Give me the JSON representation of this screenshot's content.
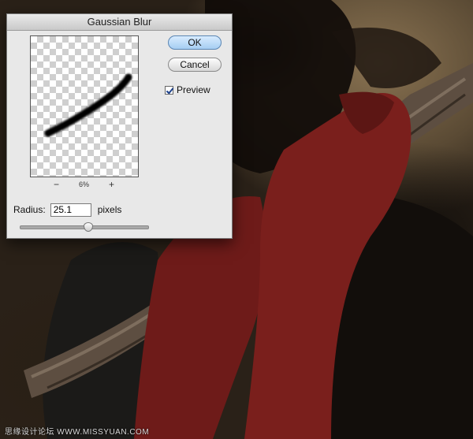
{
  "dialog": {
    "title": "Gaussian Blur",
    "ok_label": "OK",
    "cancel_label": "Cancel",
    "preview_label": "Preview",
    "preview_checked": true,
    "zoom_out": "−",
    "zoom_level": "6%",
    "zoom_in": "+",
    "radius_label": "Radius:",
    "radius_value": "25.1",
    "radius_unit": "pixels",
    "slider_fraction": 0.53
  },
  "watermark": "思缘设计论坛 WWW.MISSYUAN.COM",
  "colors": {
    "ok_accent": "#a6cdf2",
    "dialog_bg": "#e8e8e8",
    "sleeve": "#7a1f1c",
    "branch": "#6b5a4a"
  }
}
